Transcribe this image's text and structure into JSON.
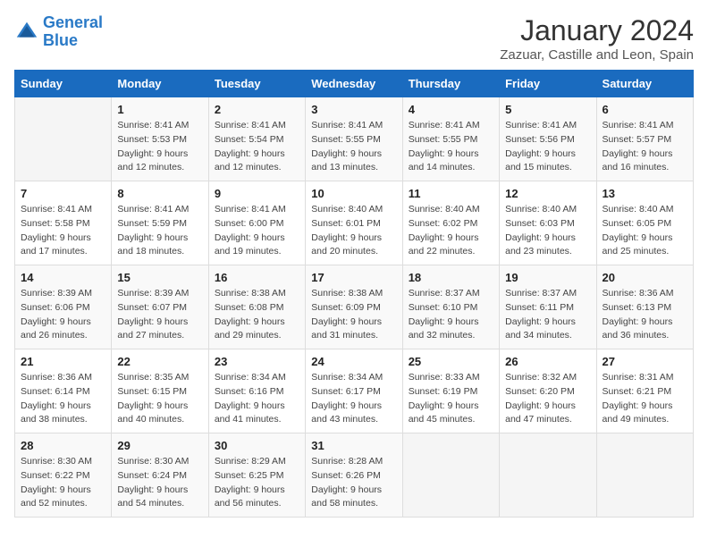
{
  "header": {
    "logo_line1": "General",
    "logo_line2": "Blue",
    "month_year": "January 2024",
    "location": "Zazuar, Castille and Leon, Spain"
  },
  "weekdays": [
    "Sunday",
    "Monday",
    "Tuesday",
    "Wednesday",
    "Thursday",
    "Friday",
    "Saturday"
  ],
  "weeks": [
    [
      {
        "day": "",
        "sunrise": "",
        "sunset": "",
        "daylight": ""
      },
      {
        "day": "1",
        "sunrise": "Sunrise: 8:41 AM",
        "sunset": "Sunset: 5:53 PM",
        "daylight": "Daylight: 9 hours and 12 minutes."
      },
      {
        "day": "2",
        "sunrise": "Sunrise: 8:41 AM",
        "sunset": "Sunset: 5:54 PM",
        "daylight": "Daylight: 9 hours and 12 minutes."
      },
      {
        "day": "3",
        "sunrise": "Sunrise: 8:41 AM",
        "sunset": "Sunset: 5:55 PM",
        "daylight": "Daylight: 9 hours and 13 minutes."
      },
      {
        "day": "4",
        "sunrise": "Sunrise: 8:41 AM",
        "sunset": "Sunset: 5:55 PM",
        "daylight": "Daylight: 9 hours and 14 minutes."
      },
      {
        "day": "5",
        "sunrise": "Sunrise: 8:41 AM",
        "sunset": "Sunset: 5:56 PM",
        "daylight": "Daylight: 9 hours and 15 minutes."
      },
      {
        "day": "6",
        "sunrise": "Sunrise: 8:41 AM",
        "sunset": "Sunset: 5:57 PM",
        "daylight": "Daylight: 9 hours and 16 minutes."
      }
    ],
    [
      {
        "day": "7",
        "sunrise": "Sunrise: 8:41 AM",
        "sunset": "Sunset: 5:58 PM",
        "daylight": "Daylight: 9 hours and 17 minutes."
      },
      {
        "day": "8",
        "sunrise": "Sunrise: 8:41 AM",
        "sunset": "Sunset: 5:59 PM",
        "daylight": "Daylight: 9 hours and 18 minutes."
      },
      {
        "day": "9",
        "sunrise": "Sunrise: 8:41 AM",
        "sunset": "Sunset: 6:00 PM",
        "daylight": "Daylight: 9 hours and 19 minutes."
      },
      {
        "day": "10",
        "sunrise": "Sunrise: 8:40 AM",
        "sunset": "Sunset: 6:01 PM",
        "daylight": "Daylight: 9 hours and 20 minutes."
      },
      {
        "day": "11",
        "sunrise": "Sunrise: 8:40 AM",
        "sunset": "Sunset: 6:02 PM",
        "daylight": "Daylight: 9 hours and 22 minutes."
      },
      {
        "day": "12",
        "sunrise": "Sunrise: 8:40 AM",
        "sunset": "Sunset: 6:03 PM",
        "daylight": "Daylight: 9 hours and 23 minutes."
      },
      {
        "day": "13",
        "sunrise": "Sunrise: 8:40 AM",
        "sunset": "Sunset: 6:05 PM",
        "daylight": "Daylight: 9 hours and 25 minutes."
      }
    ],
    [
      {
        "day": "14",
        "sunrise": "Sunrise: 8:39 AM",
        "sunset": "Sunset: 6:06 PM",
        "daylight": "Daylight: 9 hours and 26 minutes."
      },
      {
        "day": "15",
        "sunrise": "Sunrise: 8:39 AM",
        "sunset": "Sunset: 6:07 PM",
        "daylight": "Daylight: 9 hours and 27 minutes."
      },
      {
        "day": "16",
        "sunrise": "Sunrise: 8:38 AM",
        "sunset": "Sunset: 6:08 PM",
        "daylight": "Daylight: 9 hours and 29 minutes."
      },
      {
        "day": "17",
        "sunrise": "Sunrise: 8:38 AM",
        "sunset": "Sunset: 6:09 PM",
        "daylight": "Daylight: 9 hours and 31 minutes."
      },
      {
        "day": "18",
        "sunrise": "Sunrise: 8:37 AM",
        "sunset": "Sunset: 6:10 PM",
        "daylight": "Daylight: 9 hours and 32 minutes."
      },
      {
        "day": "19",
        "sunrise": "Sunrise: 8:37 AM",
        "sunset": "Sunset: 6:11 PM",
        "daylight": "Daylight: 9 hours and 34 minutes."
      },
      {
        "day": "20",
        "sunrise": "Sunrise: 8:36 AM",
        "sunset": "Sunset: 6:13 PM",
        "daylight": "Daylight: 9 hours and 36 minutes."
      }
    ],
    [
      {
        "day": "21",
        "sunrise": "Sunrise: 8:36 AM",
        "sunset": "Sunset: 6:14 PM",
        "daylight": "Daylight: 9 hours and 38 minutes."
      },
      {
        "day": "22",
        "sunrise": "Sunrise: 8:35 AM",
        "sunset": "Sunset: 6:15 PM",
        "daylight": "Daylight: 9 hours and 40 minutes."
      },
      {
        "day": "23",
        "sunrise": "Sunrise: 8:34 AM",
        "sunset": "Sunset: 6:16 PM",
        "daylight": "Daylight: 9 hours and 41 minutes."
      },
      {
        "day": "24",
        "sunrise": "Sunrise: 8:34 AM",
        "sunset": "Sunset: 6:17 PM",
        "daylight": "Daylight: 9 hours and 43 minutes."
      },
      {
        "day": "25",
        "sunrise": "Sunrise: 8:33 AM",
        "sunset": "Sunset: 6:19 PM",
        "daylight": "Daylight: 9 hours and 45 minutes."
      },
      {
        "day": "26",
        "sunrise": "Sunrise: 8:32 AM",
        "sunset": "Sunset: 6:20 PM",
        "daylight": "Daylight: 9 hours and 47 minutes."
      },
      {
        "day": "27",
        "sunrise": "Sunrise: 8:31 AM",
        "sunset": "Sunset: 6:21 PM",
        "daylight": "Daylight: 9 hours and 49 minutes."
      }
    ],
    [
      {
        "day": "28",
        "sunrise": "Sunrise: 8:30 AM",
        "sunset": "Sunset: 6:22 PM",
        "daylight": "Daylight: 9 hours and 52 minutes."
      },
      {
        "day": "29",
        "sunrise": "Sunrise: 8:30 AM",
        "sunset": "Sunset: 6:24 PM",
        "daylight": "Daylight: 9 hours and 54 minutes."
      },
      {
        "day": "30",
        "sunrise": "Sunrise: 8:29 AM",
        "sunset": "Sunset: 6:25 PM",
        "daylight": "Daylight: 9 hours and 56 minutes."
      },
      {
        "day": "31",
        "sunrise": "Sunrise: 8:28 AM",
        "sunset": "Sunset: 6:26 PM",
        "daylight": "Daylight: 9 hours and 58 minutes."
      },
      {
        "day": "",
        "sunrise": "",
        "sunset": "",
        "daylight": ""
      },
      {
        "day": "",
        "sunrise": "",
        "sunset": "",
        "daylight": ""
      },
      {
        "day": "",
        "sunrise": "",
        "sunset": "",
        "daylight": ""
      }
    ]
  ]
}
